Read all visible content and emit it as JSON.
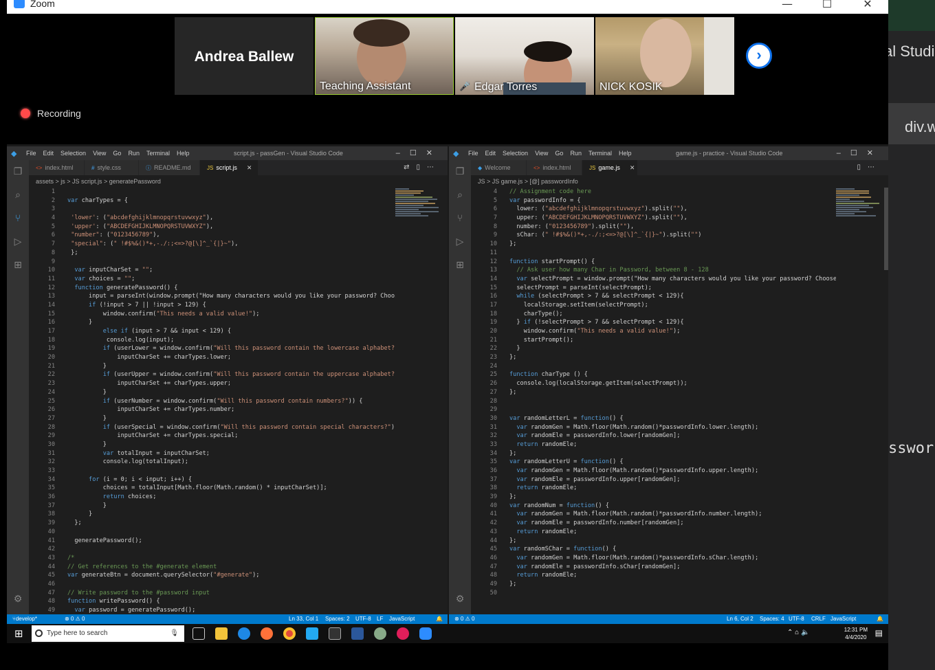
{
  "zoom": {
    "title": "Zoom",
    "recording_label": "Recording",
    "participants": [
      {
        "name": "Andrea Ballew"
      },
      {
        "name": "Teaching Assistant"
      },
      {
        "name": "Edgar Torres"
      },
      {
        "name": "NICK KOSIK"
      }
    ]
  },
  "left_editor": {
    "menu": [
      "File",
      "Edit",
      "Selection",
      "View",
      "Go",
      "Run",
      "Terminal",
      "Help"
    ],
    "title": "script.js - passGen - Visual Studio Code",
    "tabs": [
      "index.html",
      "style.css",
      "README.md",
      "script.js"
    ],
    "active_tab": "script.js",
    "breadcrumb": "assets > js > JS script.js > generatePassword",
    "lines": [
      {
        "n": "1",
        "t": ""
      },
      {
        "n": "2",
        "t": "var charTypes = {"
      },
      {
        "n": "3",
        "t": ""
      },
      {
        "n": "4",
        "t": " 'lower': (\"abcdefghijklmnopqrstuvwxyz\"),"
      },
      {
        "n": "5",
        "t": " 'upper': (\"ABCDEFGHIJKLMNOPQRSTUVWXYZ\"),"
      },
      {
        "n": "6",
        "t": " \"number\": (\"0123456789\"),"
      },
      {
        "n": "7",
        "t": " \"special\": (\" !#$%&()*+,-./:;<=>?@[\\]^_`{|}~\"),"
      },
      {
        "n": "8",
        "t": " };"
      },
      {
        "n": "9",
        "t": ""
      },
      {
        "n": "10",
        "t": "  var inputCharSet = \"\";"
      },
      {
        "n": "11",
        "t": "  var choices = \"\";"
      },
      {
        "n": "12",
        "t": "  function generatePassword() {"
      },
      {
        "n": "13",
        "t": "      input = parseInt(window.prompt(\"How many characters would you like your password? Choose"
      },
      {
        "n": "14",
        "t": "      if (!input > 7 || !input > 129) {"
      },
      {
        "n": "15",
        "t": "          window.confirm(\"This needs a valid value!\");"
      },
      {
        "n": "16",
        "t": "      }"
      },
      {
        "n": "17",
        "t": "          else if (input > 7 && input < 129) {"
      },
      {
        "n": "18",
        "t": "           console.log(input);"
      },
      {
        "n": "19",
        "t": "          if (userLower = window.confirm(\"Will this password contain the lowercase alphabet?\")"
      },
      {
        "n": "20",
        "t": "              inputCharSet += charTypes.lower;"
      },
      {
        "n": "21",
        "t": "          }"
      },
      {
        "n": "22",
        "t": "          if (userUpper = window.confirm(\"Will this password contain the uppercase alphabet?\")"
      },
      {
        "n": "23",
        "t": "              inputCharSet += charTypes.upper;"
      },
      {
        "n": "24",
        "t": "          }"
      },
      {
        "n": "25",
        "t": "          if (userNumber = window.confirm(\"Will this password contain numbers?\")) {"
      },
      {
        "n": "26",
        "t": "              inputCharSet += charTypes.number;"
      },
      {
        "n": "27",
        "t": "          }"
      },
      {
        "n": "28",
        "t": "          if (userSpecial = window.confirm(\"Will this password contain special characters?\")) {"
      },
      {
        "n": "29",
        "t": "              inputCharSet += charTypes.special;"
      },
      {
        "n": "30",
        "t": "          }"
      },
      {
        "n": "31",
        "t": "          var totalInput = inputCharSet;"
      },
      {
        "n": "32",
        "t": "          console.log(totalInput);"
      },
      {
        "n": "33",
        "t": ""
      },
      {
        "n": "34",
        "t": "      for (i = 0; i < input; i++) {"
      },
      {
        "n": "35",
        "t": "          choices = totalInput[Math.floor(Math.random() * inputCharSet)];"
      },
      {
        "n": "36",
        "t": "          return choices;"
      },
      {
        "n": "37",
        "t": "          }"
      },
      {
        "n": "38",
        "t": "      }"
      },
      {
        "n": "39",
        "t": "  };"
      },
      {
        "n": "40",
        "t": ""
      },
      {
        "n": "41",
        "t": "  generatePassword();"
      },
      {
        "n": "42",
        "t": ""
      },
      {
        "n": "43",
        "t": "/*"
      },
      {
        "n": "44",
        "t": "// Get references to the #generate element"
      },
      {
        "n": "45",
        "t": "var generateBtn = document.querySelector(\"#generate\");"
      },
      {
        "n": "46",
        "t": ""
      },
      {
        "n": "47",
        "t": "// Write password to the #password input"
      },
      {
        "n": "48",
        "t": "function writePassword() {"
      },
      {
        "n": "49",
        "t": "  var password = generatePassword();"
      }
    ],
    "status": {
      "branch": "develop*",
      "problems": "⊗ 0 ⚠ 0",
      "position": "Ln 33, Col 1",
      "spaces": "Spaces: 2",
      "encoding": "UTF-8",
      "eol": "LF",
      "language": "JavaScript"
    }
  },
  "right_editor": {
    "menu": [
      "File",
      "Edit",
      "Selection",
      "View",
      "Go",
      "Run",
      "Terminal",
      "Help"
    ],
    "title": "game.js - practice - Visual Studio Code",
    "tabs": [
      "Welcome",
      "index.html",
      "game.js"
    ],
    "active_tab": "game.js",
    "breadcrumb": "JS > JS game.js > [@] passwordInfo",
    "lines": [
      {
        "n": "4",
        "t": "// Assignment code here"
      },
      {
        "n": "5",
        "t": "var passwordInfo = {"
      },
      {
        "n": "6",
        "t": "  lower: (\"abcdefghijklmnopqrstuvwxyz\").split(\"\"),"
      },
      {
        "n": "7",
        "t": "  upper: (\"ABCDEFGHIJKLMNOPQRSTUVWXYZ\").split(\"\"),"
      },
      {
        "n": "8",
        "t": "  number: (\"0123456789\").split(\"\"),"
      },
      {
        "n": "9",
        "t": "  sChar: (\" !#$%&()*+,-./:;<=>?@[\\]^_`{|}~\").split(\"\")"
      },
      {
        "n": "10",
        "t": "};"
      },
      {
        "n": "11",
        "t": ""
      },
      {
        "n": "12",
        "t": "function startPrompt() {"
      },
      {
        "n": "13",
        "t": "  // Ask user how many Char in Password, between 8 - 128"
      },
      {
        "n": "14",
        "t": "  var selectPrompt = window.prompt(\"How many characters would you like your password? Choose b"
      },
      {
        "n": "15",
        "t": "  selectPrompt = parseInt(selectPrompt);"
      },
      {
        "n": "16",
        "t": "  while (selectPrompt > 7 && selectPrompt < 129){"
      },
      {
        "n": "17",
        "t": "    localStorage.setItem(selectPrompt);"
      },
      {
        "n": "18",
        "t": "    charType();"
      },
      {
        "n": "19",
        "t": "  } if (!selectPrompt > 7 && selectPrompt < 129){"
      },
      {
        "n": "20",
        "t": "    window.confirm(\"This needs a valid value!\");"
      },
      {
        "n": "21",
        "t": "    startPrompt();"
      },
      {
        "n": "22",
        "t": "  }"
      },
      {
        "n": "23",
        "t": "};"
      },
      {
        "n": "24",
        "t": ""
      },
      {
        "n": "25",
        "t": "function charType () {"
      },
      {
        "n": "26",
        "t": "  console.log(localStorage.getItem(selectPrompt));"
      },
      {
        "n": "27",
        "t": "};"
      },
      {
        "n": "28",
        "t": ""
      },
      {
        "n": "29",
        "t": ""
      },
      {
        "n": "30",
        "t": "var randomLetterL = function() {"
      },
      {
        "n": "31",
        "t": "  var randomGen = Math.floor(Math.random()*passwordInfo.lower.length);"
      },
      {
        "n": "32",
        "t": "  var randomEle = passwordInfo.lower[randomGen];"
      },
      {
        "n": "33",
        "t": "  return randomEle;"
      },
      {
        "n": "34",
        "t": "};"
      },
      {
        "n": "35",
        "t": "var randomLetterU = function() {"
      },
      {
        "n": "36",
        "t": "  var randomGen = Math.floor(Math.random()*passwordInfo.upper.length);"
      },
      {
        "n": "37",
        "t": "  var randomEle = passwordInfo.upper[randomGen];"
      },
      {
        "n": "38",
        "t": "  return randomEle;"
      },
      {
        "n": "39",
        "t": "};"
      },
      {
        "n": "40",
        "t": "var randomNum = function() {"
      },
      {
        "n": "41",
        "t": "  var randomGen = Math.floor(Math.random()*passwordInfo.number.length);"
      },
      {
        "n": "42",
        "t": "  var randomEle = passwordInfo.number[randomGen];"
      },
      {
        "n": "43",
        "t": "  return randomEle;"
      },
      {
        "n": "44",
        "t": "};"
      },
      {
        "n": "45",
        "t": "var randomSChar = function() {"
      },
      {
        "n": "46",
        "t": "  var randomGen = Math.floor(Math.random()*passwordInfo.sChar.length);"
      },
      {
        "n": "47",
        "t": "  var randomEle = passwordInfo.sChar[randomGen];"
      },
      {
        "n": "48",
        "t": "  return randomEle;"
      },
      {
        "n": "49",
        "t": "};"
      },
      {
        "n": "50",
        "t": ""
      }
    ],
    "status": {
      "problems": "⊗ 0 ⚠ 0",
      "position": "Ln 6, Col 2",
      "spaces": "Spaces: 4",
      "encoding": "UTF-8",
      "eol": "CRLF",
      "language": "JavaScript"
    }
  },
  "taskbar": {
    "search_placeholder": "Type here to search",
    "time": "12:31 PM",
    "date": "4/4/2020"
  },
  "background": {
    "text1": "al Studi",
    "text2": "div.w",
    "text3": "sswor"
  },
  "colors": {
    "vscode_blue": "#007acc",
    "zoom_blue": "#0e71eb",
    "record_red": "#ff4a4a"
  }
}
